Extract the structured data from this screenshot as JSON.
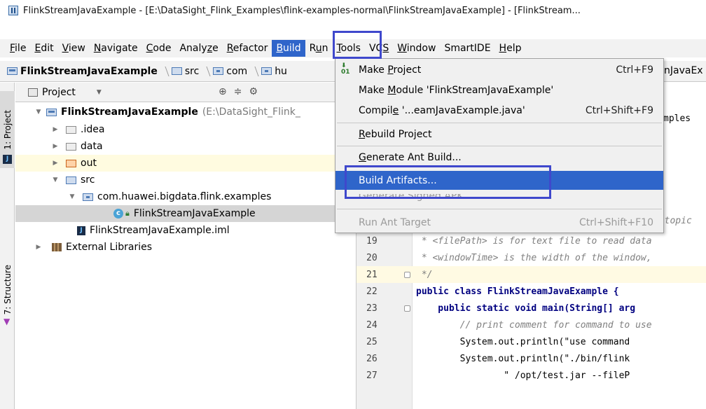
{
  "window": {
    "title": "FlinkStreamJavaExample - [E:\\DataSight_Flink_Examples\\flink-examples-normal\\FlinkStreamJavaExample] - [FlinkStream..."
  },
  "menubar": [
    {
      "label": "File",
      "mn": "F",
      "rest": "ile"
    },
    {
      "label": "Edit",
      "mn": "E",
      "rest": "dit"
    },
    {
      "label": "View",
      "mn": "V",
      "rest": "iew"
    },
    {
      "label": "Navigate",
      "mn": "N",
      "rest": "avigate"
    },
    {
      "label": "Code",
      "mn": "C",
      "rest": "ode"
    },
    {
      "label": "Analyze",
      "pre": "Analy",
      "mn": "z",
      "rest": "e"
    },
    {
      "label": "Refactor",
      "mn": "R",
      "rest": "efactor"
    },
    {
      "label": "Build",
      "mn": "B",
      "rest": "uild"
    },
    {
      "label": "Run",
      "pre": "R",
      "mn": "u",
      "rest": "n"
    },
    {
      "label": "Tools",
      "mn": "T",
      "rest": "ools"
    },
    {
      "label": "VCS",
      "pre": "VC",
      "mn": "S",
      "rest": ""
    },
    {
      "label": "Window",
      "mn": "W",
      "rest": "indow"
    },
    {
      "label": "SmartIDE",
      "pre": "",
      "mn": "",
      "rest": "SmartIDE"
    },
    {
      "label": "Help",
      "mn": "H",
      "rest": "elp"
    }
  ],
  "breadcrumb": {
    "project": "FlinkStreamJavaExample",
    "src": "src",
    "com": "com",
    "hu": "hu",
    "right_fragment": "nJavaEx"
  },
  "panel": {
    "title": "Project",
    "tabs": {
      "project": "1: Project",
      "structure": "7: Structure"
    }
  },
  "tree": {
    "root": {
      "label": "FlinkStreamJavaExample",
      "path": "(E:\\DataSight_Flink_"
    },
    "idea": ".idea",
    "data": "data",
    "out": "out",
    "src": "src",
    "pkg": "com.huawei.bigdata.flink.examples",
    "cls": "FlinkStreamJavaExample",
    "iml": "FlinkStreamJavaExample.iml",
    "libs": "External Libraries"
  },
  "build_menu": {
    "make_project": {
      "label": "Make Project",
      "mn": "P",
      "pre": "Make ",
      "rest": "roject",
      "shortcut": "Ctrl+F9"
    },
    "make_module": {
      "label": "Make Module 'FlinkStreamJavaExample'",
      "pre": "Make ",
      "mn": "M",
      "rest": "odule 'FlinkStreamJavaExample'"
    },
    "compile": {
      "label": "Compile '...eamJavaExample.java'",
      "pre": "Compil",
      "mn": "e",
      "rest": " '...eamJavaExample.java'",
      "shortcut": "Ctrl+Shift+F9"
    },
    "rebuild": {
      "label": "Rebuild Project",
      "mn": "R",
      "rest": "ebuild Project"
    },
    "generate_ant": {
      "label": "Generate Ant Build...",
      "mn": "G",
      "rest": "enerate Ant Build..."
    },
    "build_artifacts": {
      "label": "Build Artifacts..."
    },
    "generate_apk": {
      "label": "Generate Signed APK..."
    },
    "run_ant": {
      "label": "Run Ant Target",
      "shortcut": "Ctrl+Shift+F10"
    }
  },
  "editor": {
    "fragments": {
      "mples": "mples",
      "topic": "e topic"
    },
    "lines": [
      {
        "n": "19",
        "text": " * <filePath> is for text file to read data"
      },
      {
        "n": "20",
        "text": " * <windowTime> is the width of the window,"
      },
      {
        "n": "21",
        "text": " */"
      },
      {
        "n": "22",
        "text": "public class FlinkStreamJavaExample {"
      },
      {
        "n": "23",
        "text": "    public static void main(String[] arg"
      },
      {
        "n": "24",
        "text": "        // print comment for command to use"
      },
      {
        "n": "25",
        "text": "        System.out.println(\"use command"
      },
      {
        "n": "26",
        "text": "        System.out.println(\"./bin/flink"
      },
      {
        "n": "27",
        "text": "                \" /opt/test.jar --fileP"
      }
    ]
  },
  "colors": {
    "menu_highlight": "#2f65ca",
    "annotation_box": "#3f48cc"
  }
}
